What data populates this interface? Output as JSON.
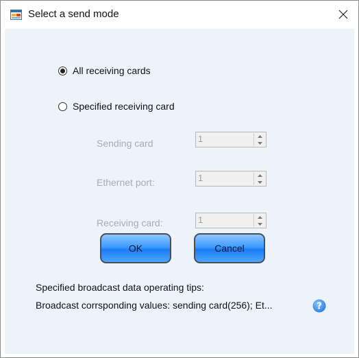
{
  "window": {
    "title": "Select a send mode",
    "app_icon": "app-window-icon",
    "close_icon": "close-icon"
  },
  "mode": {
    "options": [
      {
        "label": "All receiving cards",
        "checked": true
      },
      {
        "label": "Specified receiving card",
        "checked": false
      }
    ]
  },
  "fields": [
    {
      "label": "Sending card",
      "value": "1",
      "enabled": false
    },
    {
      "label": "Ethernet port:",
      "value": "1",
      "enabled": false
    },
    {
      "label": "Receiving card:",
      "value": "1",
      "enabled": false
    }
  ],
  "buttons": {
    "ok_label": "OK",
    "cancel_label": "Cancel"
  },
  "tips": {
    "title": "Specified broadcast data operating tips:",
    "text": "Broadcast corrsponding values: sending card(256); Et...",
    "help_icon": "help-question-icon"
  },
  "colors": {
    "client_background": "#ecf3fb",
    "button_blue": "#3f9bff",
    "disabled_text": "#a8acb3",
    "help_icon_blue": "#2f7fe0"
  }
}
